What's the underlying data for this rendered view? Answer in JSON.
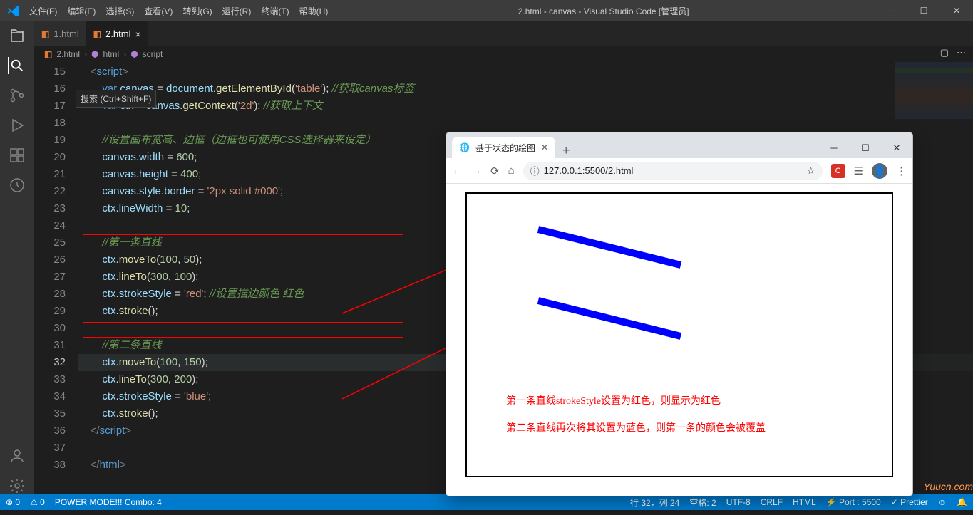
{
  "titlebar": {
    "menus": [
      "文件(F)",
      "编辑(E)",
      "选择(S)",
      "查看(V)",
      "转到(G)",
      "运行(R)",
      "终端(T)",
      "帮助(H)"
    ],
    "title": "2.html - canvas - Visual Studio Code [管理员]"
  },
  "tabs": [
    {
      "label": "1.html",
      "active": false
    },
    {
      "label": "2.html",
      "active": true
    }
  ],
  "breadcrumb": {
    "file": "2.html",
    "parts": [
      "html",
      "script"
    ]
  },
  "tooltip": "搜索 (Ctrl+Shift+F)",
  "gutter_start": 15,
  "code_lines": [
    {
      "n": 15,
      "html": "    <span class='tk-t'>&lt;</span><span class='tk-tn'>script</span><span class='tk-t'>&gt;</span>"
    },
    {
      "n": 16,
      "html": "        <span class='tk-k'>var</span> <span class='tk-v'>canvas</span> <span class='tk-p'>=</span> <span class='tk-v'>document</span><span class='tk-p'>.</span><span class='tk-f'>getElementById</span><span class='tk-p'>(</span><span class='tk-s'>'table'</span><span class='tk-p'>);</span> <span class='tk-c'>//获取canvas标签</span>"
    },
    {
      "n": 17,
      "html": "        <span class='tk-k'>var</span> <span class='tk-v'>ctx</span> <span class='tk-p'>=</span> <span class='tk-v'>canvas</span><span class='tk-p'>.</span><span class='tk-f'>getContext</span><span class='tk-p'>(</span><span class='tk-s'>'2d'</span><span class='tk-p'>);</span> <span class='tk-c'>//获取上下文</span>"
    },
    {
      "n": 18,
      "html": " "
    },
    {
      "n": 19,
      "html": "        <span class='tk-c'>//设置画布宽高、边框（边框也可使用CSS选择器来设定）</span>"
    },
    {
      "n": 20,
      "html": "        <span class='tk-v'>canvas</span><span class='tk-p'>.</span><span class='tk-v'>width</span> <span class='tk-p'>=</span> <span class='tk-n'>600</span><span class='tk-p'>;</span>"
    },
    {
      "n": 21,
      "html": "        <span class='tk-v'>canvas</span><span class='tk-p'>.</span><span class='tk-v'>height</span> <span class='tk-p'>=</span> <span class='tk-n'>400</span><span class='tk-p'>;</span>"
    },
    {
      "n": 22,
      "html": "        <span class='tk-v'>canvas</span><span class='tk-p'>.</span><span class='tk-v'>style</span><span class='tk-p'>.</span><span class='tk-v'>border</span> <span class='tk-p'>=</span> <span class='tk-s'>'2px solid #000'</span><span class='tk-p'>;</span>"
    },
    {
      "n": 23,
      "html": "        <span class='tk-v'>ctx</span><span class='tk-p'>.</span><span class='tk-v'>lineWidth</span> <span class='tk-p'>=</span> <span class='tk-n'>10</span><span class='tk-p'>;</span>"
    },
    {
      "n": 24,
      "html": " "
    },
    {
      "n": 25,
      "html": "        <span class='tk-c'>//第一条直线</span>"
    },
    {
      "n": 26,
      "html": "        <span class='tk-v'>ctx</span><span class='tk-p'>.</span><span class='tk-f'>moveTo</span><span class='tk-p'>(</span><span class='tk-n'>100</span><span class='tk-p'>, </span><span class='tk-n'>50</span><span class='tk-p'>);</span>"
    },
    {
      "n": 27,
      "html": "        <span class='tk-v'>ctx</span><span class='tk-p'>.</span><span class='tk-f'>lineTo</span><span class='tk-p'>(</span><span class='tk-n'>300</span><span class='tk-p'>, </span><span class='tk-n'>100</span><span class='tk-p'>);</span>"
    },
    {
      "n": 28,
      "html": "        <span class='tk-v'>ctx</span><span class='tk-p'>.</span><span class='tk-v'>strokeStyle</span> <span class='tk-p'>=</span> <span class='tk-s'>'red'</span><span class='tk-p'>;</span> <span class='tk-c'>//设置描边颜色 红色</span>"
    },
    {
      "n": 29,
      "html": "        <span class='tk-v'>ctx</span><span class='tk-p'>.</span><span class='tk-f'>stroke</span><span class='tk-p'>();</span>"
    },
    {
      "n": 30,
      "html": " "
    },
    {
      "n": 31,
      "html": "        <span class='tk-c'>//第二条直线</span>"
    },
    {
      "n": 32,
      "html": "        <span class='tk-v'>ctx</span><span class='tk-p'>.</span><span class='tk-f'>moveTo</span><span class='tk-p'>(</span><span class='tk-n'>100</span><span class='tk-p'>, </span><span class='tk-n'>150</span><span class='tk-p'>);</span>",
      "cur": true
    },
    {
      "n": 33,
      "html": "        <span class='tk-v'>ctx</span><span class='tk-p'>.</span><span class='tk-f'>lineTo</span><span class='tk-p'>(</span><span class='tk-n'>300</span><span class='tk-p'>, </span><span class='tk-n'>200</span><span class='tk-p'>);</span>"
    },
    {
      "n": 34,
      "html": "        <span class='tk-v'>ctx</span><span class='tk-p'>.</span><span class='tk-v'>strokeStyle</span> <span class='tk-p'>=</span> <span class='tk-s'>'blue'</span><span class='tk-p'>;</span>"
    },
    {
      "n": 35,
      "html": "        <span class='tk-v'>ctx</span><span class='tk-p'>.</span><span class='tk-f'>stroke</span><span class='tk-p'>();</span>"
    },
    {
      "n": 36,
      "html": "    <span class='tk-t'>&lt;/</span><span class='tk-tn'>script</span><span class='tk-t'>&gt;</span>"
    },
    {
      "n": 37,
      "html": " "
    },
    {
      "n": 38,
      "html": "    <span class='tk-t'>&lt;/</span><span class='tk-tn'>html</span><span class='tk-t'>&gt;</span>"
    }
  ],
  "browser": {
    "tab_title": "基于状态的绘图",
    "url": "127.0.0.1:5500/2.html",
    "notes": [
      "第一条直线strokeStyle设置为红色，则显示为红色",
      "第二条直线再次将其设置为蓝色，则第一条的颜色会被覆盖"
    ]
  },
  "statusbar": {
    "errors": "⊗ 0",
    "warnings": "⚠ 0",
    "power": "POWER MODE!!! Combo: 4",
    "pos": "行 32，列 24",
    "spaces": "空格: 2",
    "enc": "UTF-8",
    "eol": "CRLF",
    "lang": "HTML",
    "port": "⚡ Port : 5500",
    "prettier": "✓ Prettier",
    "bell": "🔔"
  },
  "watermark": "Yuucn.com"
}
